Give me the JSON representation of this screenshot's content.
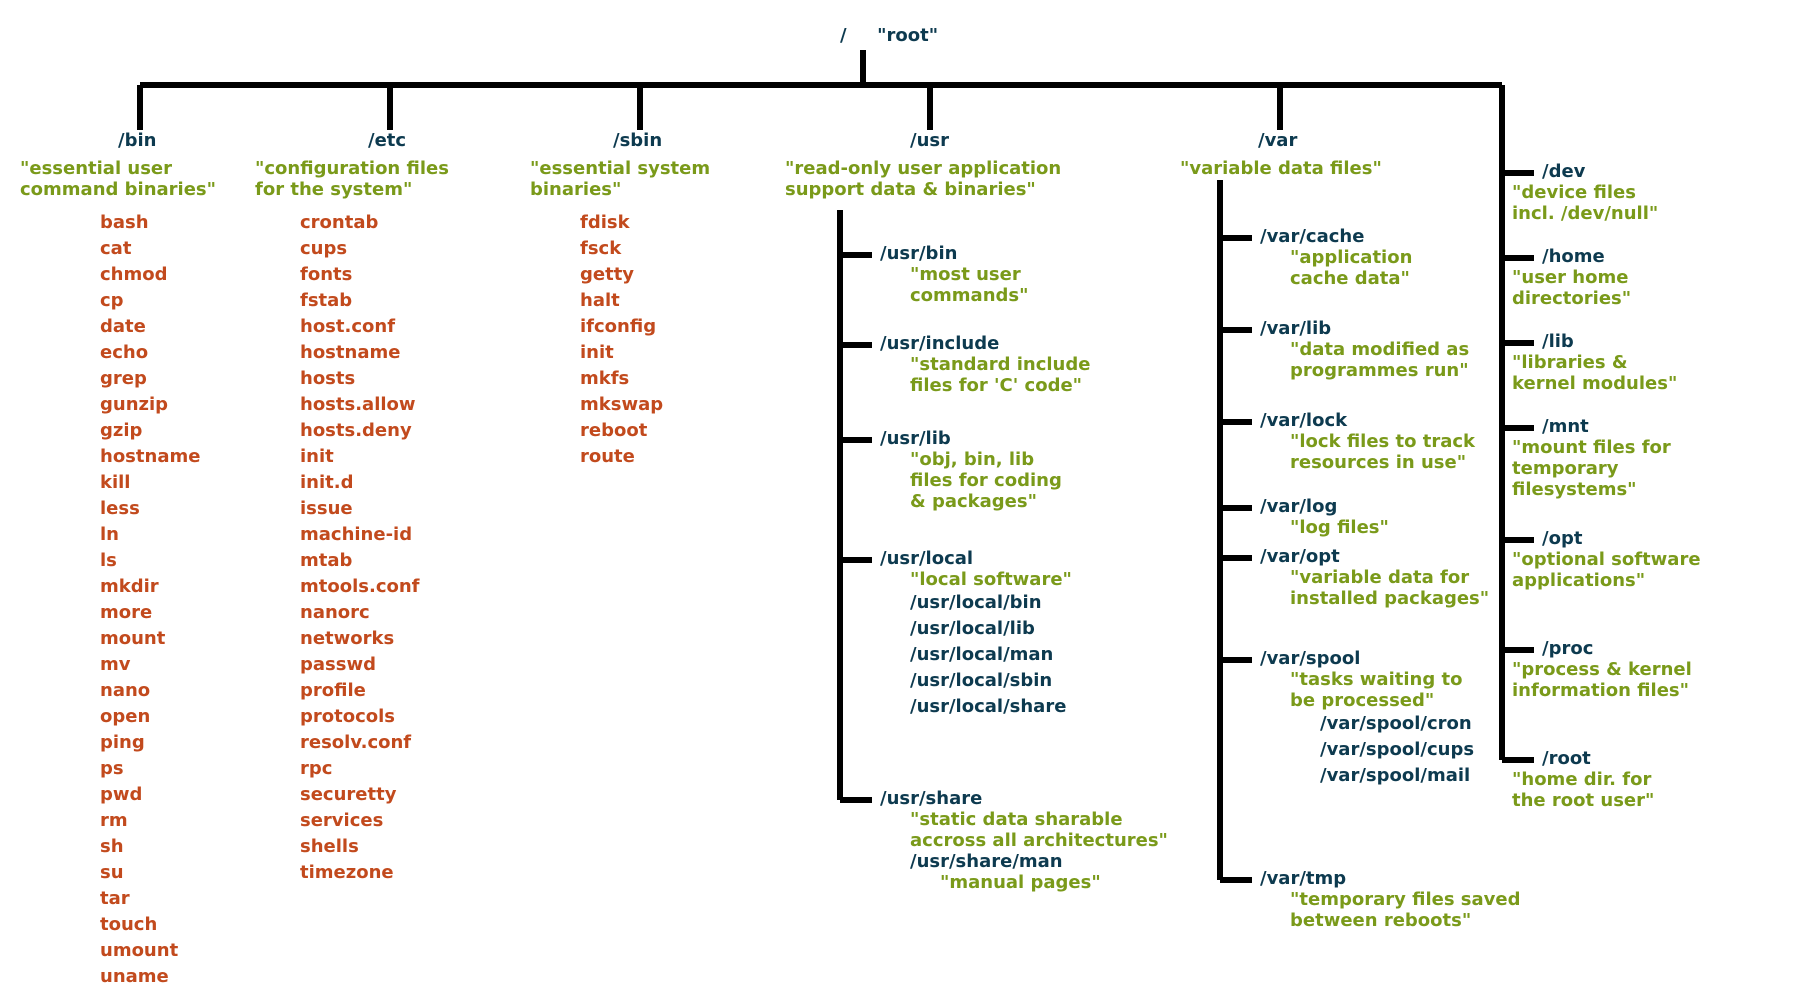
{
  "root": {
    "path": "/",
    "label": "\"root\""
  },
  "bin": {
    "path": "/bin",
    "desc": "\"essential user\ncommand binaries\""
  },
  "etc": {
    "path": "/etc",
    "desc": "\"configuration files\nfor the system\""
  },
  "sbin": {
    "path": "/sbin",
    "desc": "\"essential system\nbinaries\""
  },
  "usr": {
    "path": "/usr",
    "desc": "\"read-only user application\nsupport data & binaries\""
  },
  "var": {
    "path": "/var",
    "desc": "\"variable data files\""
  },
  "bin_cmds": [
    "bash",
    "cat",
    "chmod",
    "cp",
    "date",
    "echo",
    "grep",
    "gunzip",
    "gzip",
    "hostname",
    "kill",
    "less",
    "ln",
    "ls",
    "mkdir",
    "more",
    "mount",
    "mv",
    "nano",
    "open",
    "ping",
    "ps",
    "pwd",
    "rm",
    "sh",
    "su",
    "tar",
    "touch",
    "umount",
    "uname"
  ],
  "etc_cmds": [
    "crontab",
    "cups",
    "fonts",
    "fstab",
    "host.conf",
    "hostname",
    "hosts",
    "hosts.allow",
    "hosts.deny",
    "init",
    "init.d",
    "issue",
    "machine-id",
    "mtab",
    "mtools.conf",
    "nanorc",
    "networks",
    "passwd",
    "profile",
    "protocols",
    "resolv.conf",
    "rpc",
    "securetty",
    "services",
    "shells",
    "timezone"
  ],
  "sbin_cmds": [
    "fdisk",
    "fsck",
    "getty",
    "halt",
    "ifconfig",
    "init",
    "mkfs",
    "mkswap",
    "reboot",
    "route"
  ],
  "usr_sub": {
    "bin": {
      "path": "/usr/bin",
      "desc": "\"most user\ncommands\""
    },
    "include": {
      "path": "/usr/include",
      "desc": "\"standard include\nfiles for 'C' code\""
    },
    "lib": {
      "path": "/usr/lib",
      "desc": "\"obj, bin, lib\nfiles for coding\n& packages\""
    },
    "local": {
      "path": "/usr/local",
      "desc": "\"local software\"",
      "children": [
        "/usr/local/bin",
        "/usr/local/lib",
        "/usr/local/man",
        "/usr/local/sbin",
        "/usr/local/share"
      ]
    },
    "share": {
      "path": "/usr/share",
      "desc": "\"static data sharable\naccross all architectures\"",
      "child_path": "/usr/share/man",
      "child_desc": "\"manual pages\""
    }
  },
  "var_sub": {
    "cache": {
      "path": "/var/cache",
      "desc": "\"application\ncache data\""
    },
    "lib": {
      "path": "/var/lib",
      "desc": "\"data modified as\nprogrammes run\""
    },
    "lock": {
      "path": "/var/lock",
      "desc": "\"lock files to track\nresources in use\""
    },
    "log": {
      "path": "/var/log",
      "desc": "\"log files\""
    },
    "opt": {
      "path": "/var/opt",
      "desc": "\"variable data for\ninstalled packages\""
    },
    "spool": {
      "path": "/var/spool",
      "desc": "\"tasks waiting to\nbe processed\"",
      "children": [
        "/var/spool/cron",
        "/var/spool/cups",
        "/var/spool/mail"
      ]
    },
    "tmp": {
      "path": "/var/tmp",
      "desc": "\"temporary files saved\nbetween reboots\""
    }
  },
  "right": {
    "dev": {
      "path": "/dev",
      "desc": "\"device files\nincl. /dev/null\""
    },
    "home": {
      "path": "/home",
      "desc": "\"user home\ndirectories\""
    },
    "lib": {
      "path": "/lib",
      "desc": "\"libraries &\nkernel modules\""
    },
    "mnt": {
      "path": "/mnt",
      "desc": "\"mount files for\ntemporary\nfilesystems\""
    },
    "opt": {
      "path": "/opt",
      "desc": "\"optional software\napplications\""
    },
    "proc": {
      "path": "/proc",
      "desc": "\"process & kernel\ninformation files\""
    },
    "root": {
      "path": "/root",
      "desc": "\"home dir. for\nthe root user\""
    }
  }
}
